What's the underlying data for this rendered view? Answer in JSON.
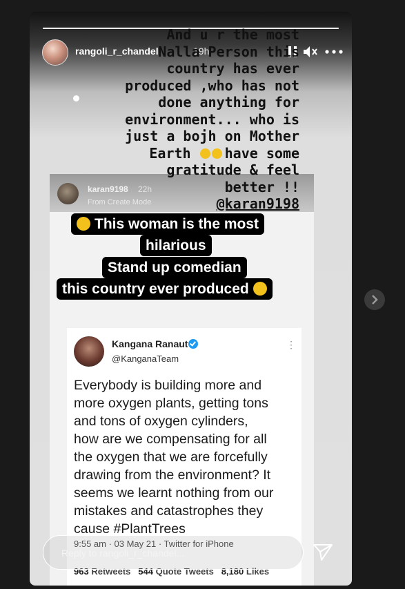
{
  "story": {
    "progress_fraction": 1.0,
    "username": "rangoli_r_chandel",
    "time_ago": "19h"
  },
  "caption": {
    "lines": [
      "And u r the most",
      "Nalla  Person this",
      "country has ever",
      "produced ,who has not",
      "done anything for",
      "environment... who is",
      "just a bojh on Mother",
      "Earth",
      "have some",
      "gratitude & feel",
      "better !!",
      "@karan9198"
    ]
  },
  "shared_story": {
    "username": "karan9198",
    "time_ago": "22h",
    "mode": "From Create Mode",
    "sticker_lines": [
      "This woman is the most",
      "hilarious",
      "Stand up comedian",
      "this country ever produced"
    ]
  },
  "tweet": {
    "name": "Kangana Ranaut",
    "handle": "@KanganaTeam",
    "body_lines": [
      "Everybody is building more and",
      "more oxygen plants, getting tons",
      "and tons of oxygen cylinders,",
      "how are we compensating for all",
      "the oxygen that we are forcefully",
      "drawing from the environment? It",
      "seems we learnt nothing from our",
      "mistakes and catastrophes they",
      "cause #PlantTrees"
    ],
    "meta": "9:55 am · 03 May 21 · Twitter for iPhone",
    "retweets": "963",
    "retweets_label": "Retweets",
    "quotes": "544",
    "quotes_label": "Quote Tweets",
    "likes": "8,180",
    "likes_label": "Likes"
  },
  "reply": {
    "placeholder": "Reply to rangoli_r_chandel..."
  },
  "icons": {
    "pause": "pause-icon",
    "mute": "speaker-muted-icon",
    "more": "more-horizontal-icon",
    "send": "paper-plane-icon",
    "next": "chevron-right-icon",
    "verified": "verified-badge-icon",
    "emoji": "laughing-emoji-icon"
  },
  "colors": {
    "background": "#1a1a1a",
    "sticker_bg": "#000000",
    "verified": "#1d9bf0",
    "emoji": "#f3c11b"
  }
}
